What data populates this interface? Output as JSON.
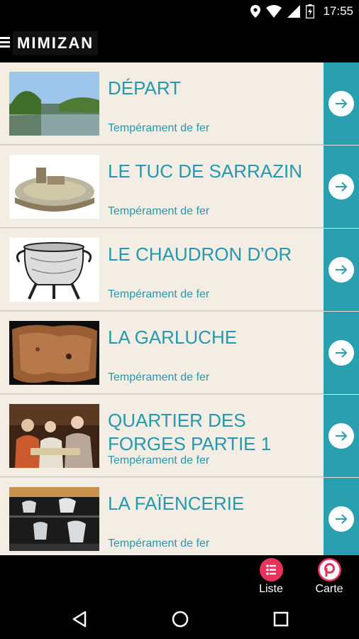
{
  "status_bar": {
    "time": "17:55",
    "icons": [
      "location-icon",
      "wifi-icon",
      "signal-icon",
      "battery-charging-icon"
    ]
  },
  "app_bar": {
    "title": "MIMIZAN",
    "menu_icon": "hamburger-menu-icon"
  },
  "list": {
    "items": [
      {
        "title": "DÉPART",
        "subtitle": "Tempérament de fer",
        "thumb": "lake-landscape-image"
      },
      {
        "title": "LE TUC DE SARRAZIN",
        "subtitle": "Tempérament de fer",
        "thumb": "fortified-camp-illustration"
      },
      {
        "title": "LE CHAUDRON D'OR",
        "subtitle": "Tempérament de fer",
        "thumb": "cauldron-engraving"
      },
      {
        "title": "LA GARLUCHE",
        "subtitle": "Tempérament de fer",
        "thumb": "garluche-stone-image"
      },
      {
        "title": "QUARTIER DES FORGES PARTIE 1",
        "subtitle": "Tempérament de fer",
        "thumb": "painting-banquet-image"
      },
      {
        "title": "LA FAÏENCERIE",
        "subtitle": "Tempérament de fer",
        "thumb": "faience-pottery-image"
      }
    ]
  },
  "tab_bar": {
    "tabs": [
      {
        "label": "Liste",
        "icon": "list-icon"
      },
      {
        "label": "Carte",
        "icon": "map-pin-icon"
      }
    ]
  },
  "colors": {
    "accent": "#2797ae",
    "arrow_bar": "#2a9fb0",
    "tab_icon": "#e8315b",
    "item_background": "#f3ede4"
  }
}
